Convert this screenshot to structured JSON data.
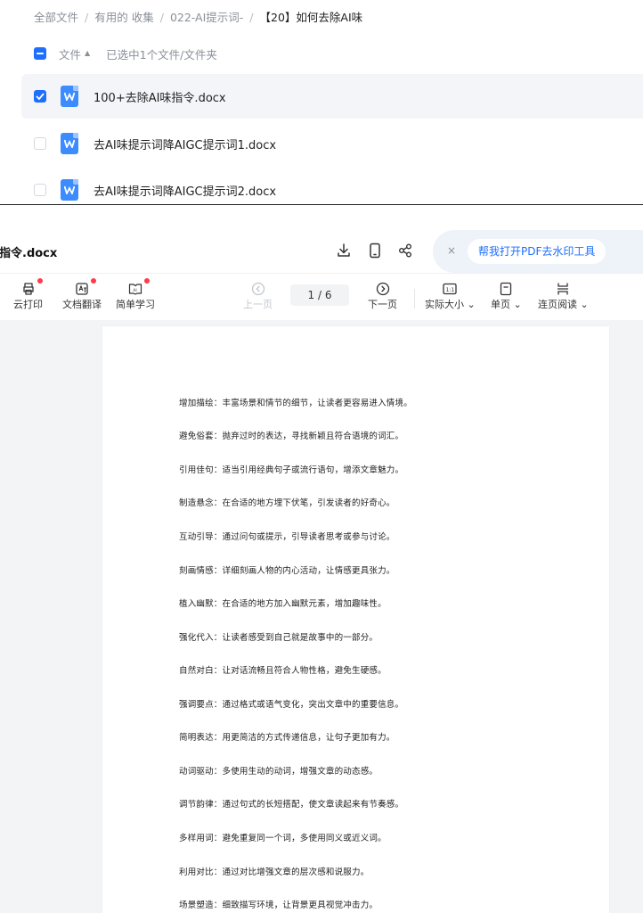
{
  "breadcrumb": {
    "items": [
      "全部文件",
      "有用的 收集",
      "022-AI提示词-"
    ],
    "separator": "/",
    "current": "【20】如何去除AI味"
  },
  "list_header": {
    "file_label": "文件",
    "sort_icon": "sort-up-icon",
    "selected_text": "已选中1个文件/文件夹"
  },
  "files": [
    {
      "name": "100+去除AI味指令.docx",
      "checked": true
    },
    {
      "name": "去AI味提示词降AIGC提示词1.docx",
      "checked": false
    },
    {
      "name": "去AI味提示词降AIGC提示词2.docx",
      "checked": false
    }
  ],
  "viewer": {
    "title": "味指令.docx",
    "top_icons": [
      "download-icon",
      "phone-icon",
      "share-icon"
    ],
    "pdf_close": "×",
    "pdf_button": "帮我打开PDF去水印工具",
    "tools": {
      "print": "云打印",
      "translate": "文档翻译",
      "learn": "简单学习",
      "prev": "上一页",
      "next": "下一页",
      "actual_size": "实际大小",
      "single_page": "单页",
      "continuous": "连页阅读"
    },
    "page_indicator": "1 / 6",
    "accent": "#1f6fff"
  },
  "document": {
    "paragraphs": [
      "增加描绘：丰富场景和情节的细节，让读者更容易进入情境。",
      "避免俗套：抛弃过时的表达，寻找新颖且符合语境的词汇。",
      "引用佳句：适当引用经典句子或流行语句，增添文章魅力。",
      "制造悬念：在合适的地方埋下伏笔，引发读者的好奇心。",
      "互动引导：通过问句或提示，引导读者思考或参与讨论。",
      "刻画情感：详细刻画人物的内心活动，让情感更具张力。",
      "植入幽默：在合适的地方加入幽默元素，增加趣味性。",
      "强化代入：让读者感受到自己就是故事中的一部分。",
      "自然对白：让对话流畅且符合人物性格，避免生硬感。",
      "强调要点：通过格式或语气变化，突出文章中的重要信息。",
      "简明表达：用更简洁的方式传递信息，让句子更加有力。",
      "动词驱动：多使用生动的动词，增强文章的动态感。",
      "调节韵律：通过句式的长短搭配，使文章读起来有节奏感。",
      "多样用词：避免重复同一个词，多使用同义或近义词。",
      "利用对比：通过对比增强文章的层次感和说服力。",
      "场景塑造：细致描写环境，让背景更具视觉冲击力。"
    ]
  }
}
